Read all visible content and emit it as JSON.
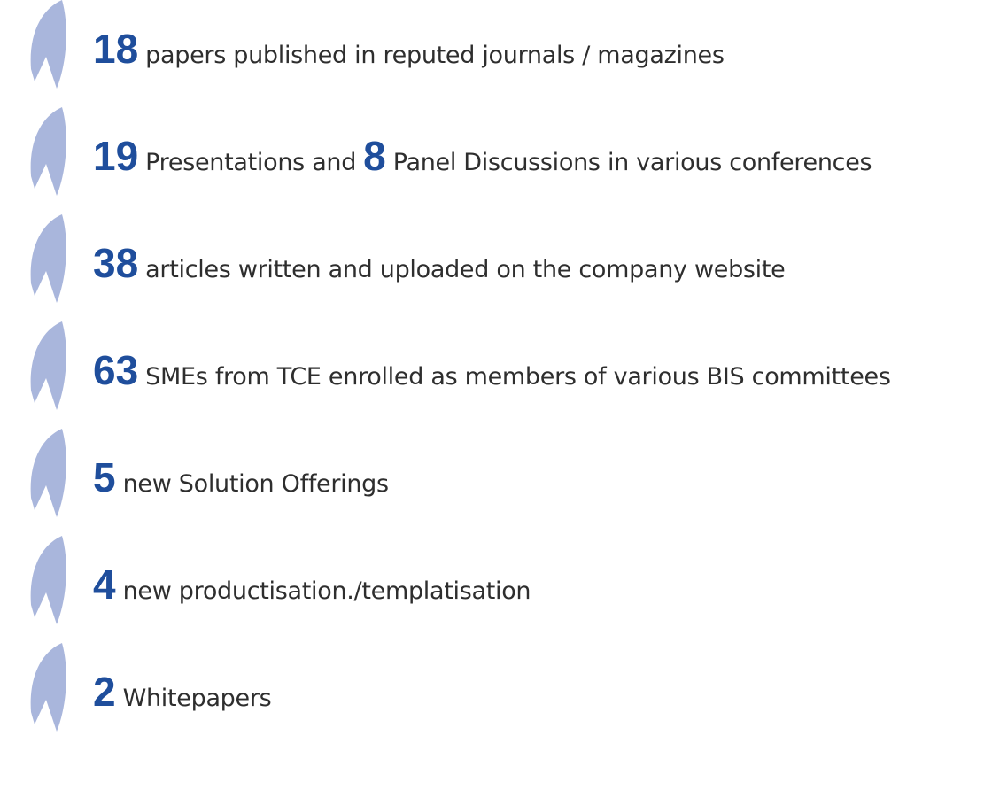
{
  "items": [
    {
      "number": "18",
      "text": "papers published in reputed journals / magazines"
    },
    {
      "number": "19",
      "text": "Presentations and",
      "number2": "8",
      "text2": "Panel Discussions in various conferences"
    },
    {
      "number": "38",
      "text": "articles written and uploaded on the company website"
    },
    {
      "number": "63",
      "text": "SMEs from TCE enrolled as members of various BIS committees"
    },
    {
      "number": "5",
      "text": "new Solution Offerings"
    },
    {
      "number": "4",
      "text": "new productisation./templatisation"
    },
    {
      "number": "2",
      "text": "Whitepapers"
    }
  ],
  "colors": {
    "number": "#1f4e9c",
    "leaf": "#a9b6dc",
    "text": "#2e2e2e"
  },
  "icons": {
    "bullet": "leaf-icon"
  }
}
